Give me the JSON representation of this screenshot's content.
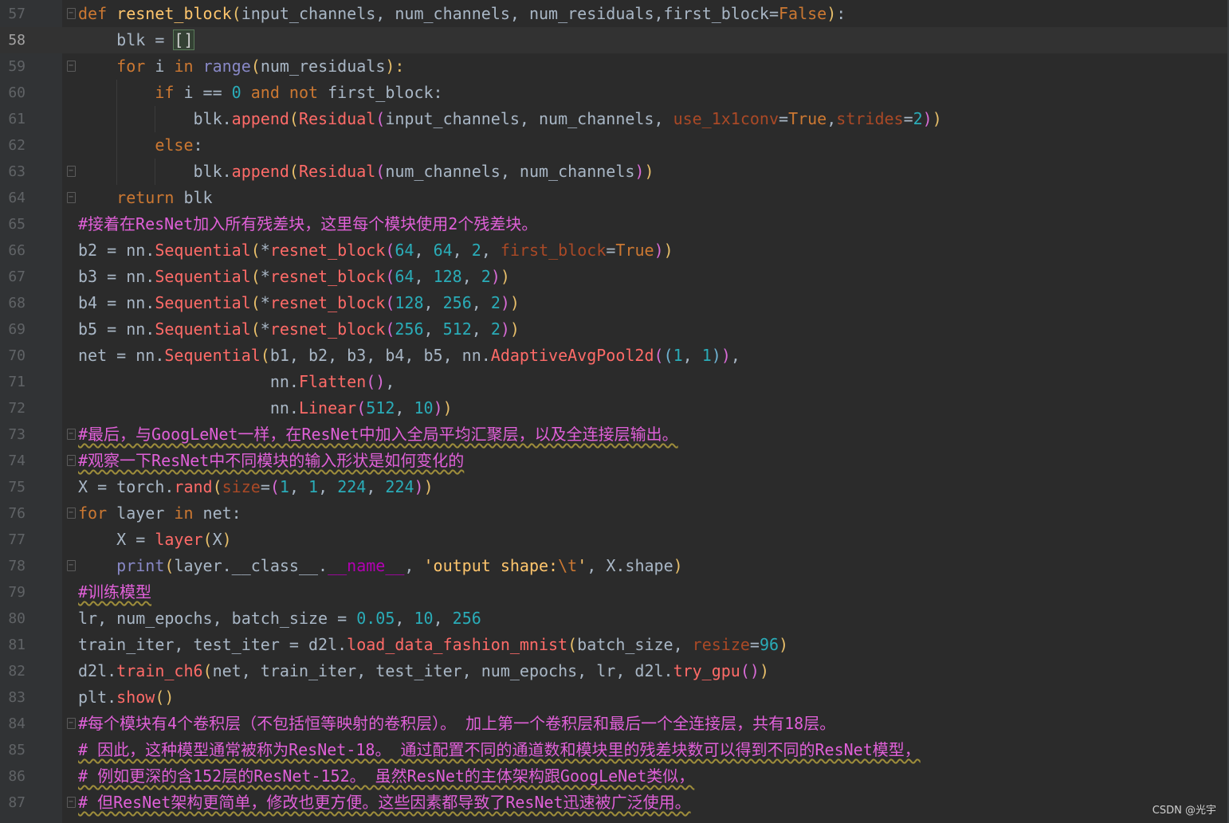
{
  "editor": {
    "lines": [
      {
        "n": "57",
        "fold": "open",
        "indent": 0,
        "current": false
      },
      {
        "n": "58",
        "fold": "",
        "indent": 1,
        "current": true
      },
      {
        "n": "59",
        "fold": "open",
        "indent": 1,
        "current": false
      },
      {
        "n": "60",
        "fold": "",
        "indent": 2,
        "current": false
      },
      {
        "n": "61",
        "fold": "",
        "indent": 3,
        "current": false
      },
      {
        "n": "62",
        "fold": "",
        "indent": 2,
        "current": false
      },
      {
        "n": "63",
        "fold": "close",
        "indent": 3,
        "current": false
      },
      {
        "n": "64",
        "fold": "close",
        "indent": 1,
        "current": false
      },
      {
        "n": "65",
        "fold": "",
        "indent": 0,
        "current": false
      },
      {
        "n": "66",
        "fold": "",
        "indent": 0,
        "current": false
      },
      {
        "n": "67",
        "fold": "",
        "indent": 0,
        "current": false
      },
      {
        "n": "68",
        "fold": "",
        "indent": 0,
        "current": false
      },
      {
        "n": "69",
        "fold": "",
        "indent": 0,
        "current": false
      },
      {
        "n": "70",
        "fold": "",
        "indent": 0,
        "current": false
      },
      {
        "n": "71",
        "fold": "",
        "indent": 0,
        "current": false
      },
      {
        "n": "72",
        "fold": "",
        "indent": 0,
        "current": false
      },
      {
        "n": "73",
        "fold": "open",
        "indent": 0,
        "current": false
      },
      {
        "n": "74",
        "fold": "close",
        "indent": 0,
        "current": false
      },
      {
        "n": "75",
        "fold": "",
        "indent": 0,
        "current": false
      },
      {
        "n": "76",
        "fold": "open",
        "indent": 0,
        "current": false
      },
      {
        "n": "77",
        "fold": "",
        "indent": 1,
        "current": false
      },
      {
        "n": "78",
        "fold": "close",
        "indent": 1,
        "current": false
      },
      {
        "n": "79",
        "fold": "",
        "indent": 0,
        "current": false
      },
      {
        "n": "80",
        "fold": "",
        "indent": 0,
        "current": false
      },
      {
        "n": "81",
        "fold": "",
        "indent": 0,
        "current": false
      },
      {
        "n": "82",
        "fold": "",
        "indent": 0,
        "current": false
      },
      {
        "n": "83",
        "fold": "",
        "indent": 0,
        "current": false
      },
      {
        "n": "84",
        "fold": "open",
        "indent": 0,
        "current": false
      },
      {
        "n": "85",
        "fold": "",
        "indent": 0,
        "current": false
      },
      {
        "n": "86",
        "fold": "",
        "indent": 0,
        "current": false
      },
      {
        "n": "87",
        "fold": "close",
        "indent": 0,
        "current": false
      }
    ],
    "code": [
      [
        [
          "kw",
          "def "
        ],
        [
          "fn",
          "resnet_block"
        ],
        [
          "br1",
          "("
        ],
        [
          "pn",
          "input_channels, num_channels, num_residuals,first_block="
        ],
        [
          "kw",
          "False"
        ],
        [
          "br1",
          ")"
        ],
        [
          "pn",
          ":"
        ]
      ],
      [
        [
          "pn",
          "    blk = "
        ],
        [
          "sel",
          "[]"
        ]
      ],
      [
        [
          "pn",
          "    "
        ],
        [
          "kw",
          "for "
        ],
        [
          "pn",
          "i "
        ],
        [
          "kw",
          "in "
        ],
        [
          "bi",
          "range"
        ],
        [
          "br1",
          "("
        ],
        [
          "pn",
          "num_residuals"
        ],
        [
          "br1",
          "):"
        ]
      ],
      [
        [
          "pn",
          "        "
        ],
        [
          "kw",
          "if "
        ],
        [
          "pn",
          "i == "
        ],
        [
          "num2",
          "0 "
        ],
        [
          "kw",
          "and not "
        ],
        [
          "pn",
          "first_block:"
        ]
      ],
      [
        [
          "pn",
          "            blk."
        ],
        [
          "call",
          "append"
        ],
        [
          "br1",
          "("
        ],
        [
          "call",
          "Residual"
        ],
        [
          "br2",
          "("
        ],
        [
          "pn",
          "input_channels, num_channels, "
        ],
        [
          "pa",
          "use_1x1conv"
        ],
        [
          "pn",
          "="
        ],
        [
          "kw",
          "True"
        ],
        [
          "pn",
          ","
        ],
        [
          "pa",
          "strides"
        ],
        [
          "pn",
          "="
        ],
        [
          "num2",
          "2"
        ],
        [
          "br2",
          ")"
        ],
        [
          "br1",
          ")"
        ]
      ],
      [
        [
          "pn",
          "        "
        ],
        [
          "kw",
          "else"
        ],
        [
          "pn",
          ":"
        ]
      ],
      [
        [
          "pn",
          "            blk."
        ],
        [
          "call",
          "append"
        ],
        [
          "br1",
          "("
        ],
        [
          "call",
          "Residual"
        ],
        [
          "br2",
          "("
        ],
        [
          "pn",
          "num_channels, num_channels"
        ],
        [
          "br2",
          ")"
        ],
        [
          "br1",
          ")"
        ]
      ],
      [
        [
          "pn",
          "    "
        ],
        [
          "kw",
          "return "
        ],
        [
          "pn",
          "blk"
        ]
      ],
      [
        [
          "cm",
          "#接着在ResNet加入所有残差块，这里每个模块使用2个残差块。"
        ]
      ],
      [
        [
          "pn",
          "b2 = nn."
        ],
        [
          "call",
          "Sequential"
        ],
        [
          "br1",
          "("
        ],
        [
          "pn",
          "*"
        ],
        [
          "call",
          "resnet_block"
        ],
        [
          "br2",
          "("
        ],
        [
          "num2",
          "64"
        ],
        [
          "pn",
          ", "
        ],
        [
          "num2",
          "64"
        ],
        [
          "pn",
          ", "
        ],
        [
          "num2",
          "2"
        ],
        [
          "pn",
          ", "
        ],
        [
          "pa",
          "first_block"
        ],
        [
          "pn",
          "="
        ],
        [
          "kw",
          "True"
        ],
        [
          "br2",
          ")"
        ],
        [
          "br1",
          ")"
        ]
      ],
      [
        [
          "pn",
          "b3 = nn."
        ],
        [
          "call",
          "Sequential"
        ],
        [
          "br1",
          "("
        ],
        [
          "pn",
          "*"
        ],
        [
          "call",
          "resnet_block"
        ],
        [
          "br2",
          "("
        ],
        [
          "num2",
          "64"
        ],
        [
          "pn",
          ", "
        ],
        [
          "num2",
          "128"
        ],
        [
          "pn",
          ", "
        ],
        [
          "num2",
          "2"
        ],
        [
          "br2",
          ")"
        ],
        [
          "br1",
          ")"
        ]
      ],
      [
        [
          "pn",
          "b4 = nn."
        ],
        [
          "call",
          "Sequential"
        ],
        [
          "br1",
          "("
        ],
        [
          "pn",
          "*"
        ],
        [
          "call",
          "resnet_block"
        ],
        [
          "br2",
          "("
        ],
        [
          "num2",
          "128"
        ],
        [
          "pn",
          ", "
        ],
        [
          "num2",
          "256"
        ],
        [
          "pn",
          ", "
        ],
        [
          "num2",
          "2"
        ],
        [
          "br2",
          ")"
        ],
        [
          "br1",
          ")"
        ]
      ],
      [
        [
          "pn",
          "b5 = nn."
        ],
        [
          "call",
          "Sequential"
        ],
        [
          "br1",
          "("
        ],
        [
          "pn",
          "*"
        ],
        [
          "call",
          "resnet_block"
        ],
        [
          "br2",
          "("
        ],
        [
          "num2",
          "256"
        ],
        [
          "pn",
          ", "
        ],
        [
          "num2",
          "512"
        ],
        [
          "pn",
          ", "
        ],
        [
          "num2",
          "2"
        ],
        [
          "br2",
          ")"
        ],
        [
          "br1",
          ")"
        ]
      ],
      [
        [
          "pn",
          "net = nn."
        ],
        [
          "call",
          "Sequential"
        ],
        [
          "br1",
          "("
        ],
        [
          "pn",
          "b1, b2, b3, b4, b5, nn."
        ],
        [
          "call",
          "AdaptiveAvgPool2d"
        ],
        [
          "br2",
          "("
        ],
        [
          "br3",
          "("
        ],
        [
          "num2",
          "1"
        ],
        [
          "pn",
          ", "
        ],
        [
          "num2",
          "1"
        ],
        [
          "br3",
          ")"
        ],
        [
          "br2",
          ")"
        ],
        [
          "pn",
          ","
        ]
      ],
      [
        [
          "pn",
          "                    nn."
        ],
        [
          "call",
          "Flatten"
        ],
        [
          "br2",
          "()"
        ],
        [
          "pn",
          ","
        ]
      ],
      [
        [
          "pn",
          "                    nn."
        ],
        [
          "call",
          "Linear"
        ],
        [
          "br2",
          "("
        ],
        [
          "num2",
          "512"
        ],
        [
          "pn",
          ", "
        ],
        [
          "num2",
          "10"
        ],
        [
          "br2",
          ")"
        ],
        [
          "br1",
          ")"
        ]
      ],
      [
        [
          "cm",
          "#最后，与GoogLeNet一样，在ResNet中加入全局平均汇聚层，以及全连接层输出。"
        ]
      ],
      [
        [
          "cm",
          "#观察一下ResNet中不同模块的输入形状是如何变化的"
        ]
      ],
      [
        [
          "pn",
          "X = torch."
        ],
        [
          "call",
          "rand"
        ],
        [
          "br1",
          "("
        ],
        [
          "pa",
          "size"
        ],
        [
          "pn",
          "="
        ],
        [
          "br2",
          "("
        ],
        [
          "num2",
          "1"
        ],
        [
          "pn",
          ", "
        ],
        [
          "num2",
          "1"
        ],
        [
          "pn",
          ", "
        ],
        [
          "num2",
          "224"
        ],
        [
          "pn",
          ", "
        ],
        [
          "num2",
          "224"
        ],
        [
          "br2",
          ")"
        ],
        [
          "br1",
          ")"
        ]
      ],
      [
        [
          "kw",
          "for "
        ],
        [
          "pn",
          "layer "
        ],
        [
          "kw",
          "in "
        ],
        [
          "pn",
          "net:"
        ]
      ],
      [
        [
          "pn",
          "    X = "
        ],
        [
          "call",
          "layer"
        ],
        [
          "br1",
          "("
        ],
        [
          "pn",
          "X"
        ],
        [
          "br1",
          ")"
        ]
      ],
      [
        [
          "pn",
          "    "
        ],
        [
          "bi",
          "print"
        ],
        [
          "br1",
          "("
        ],
        [
          "pn",
          "layer.__class__."
        ],
        [
          "magic",
          "__name__"
        ],
        [
          "pn",
          ", "
        ],
        [
          "fn",
          "'output shape:"
        ],
        [
          "esc",
          "\\t"
        ],
        [
          "fn",
          "'"
        ],
        [
          "pn",
          ", X.shape"
        ],
        [
          "br1",
          ")"
        ]
      ],
      [
        [
          "cm",
          "#训练模型"
        ]
      ],
      [
        [
          "pn",
          "lr, num_epochs, batch_size = "
        ],
        [
          "num2",
          "0.05"
        ],
        [
          "pn",
          ", "
        ],
        [
          "num2",
          "10"
        ],
        [
          "pn",
          ", "
        ],
        [
          "num2",
          "256"
        ]
      ],
      [
        [
          "pn",
          "train_iter, test_iter = d2l."
        ],
        [
          "call",
          "load_data_fashion_mnist"
        ],
        [
          "br1",
          "("
        ],
        [
          "pn",
          "batch_size, "
        ],
        [
          "pa",
          "resize"
        ],
        [
          "pn",
          "="
        ],
        [
          "num2",
          "96"
        ],
        [
          "br1",
          ")"
        ]
      ],
      [
        [
          "pn",
          "d2l."
        ],
        [
          "call",
          "train_ch6"
        ],
        [
          "br1",
          "("
        ],
        [
          "pn",
          "net, train_iter, test_iter, num_epochs, lr, d2l."
        ],
        [
          "call",
          "try_gpu"
        ],
        [
          "br2",
          "()"
        ],
        [
          "br1",
          ")"
        ]
      ],
      [
        [
          "pn",
          "plt."
        ],
        [
          "call",
          "show"
        ],
        [
          "br1",
          "()"
        ]
      ],
      [
        [
          "cm",
          "#每个模块有4个卷积层（不包括恒等映射的卷积层）。 加上第一个卷积层和最后一个全连接层，共有18层。"
        ]
      ],
      [
        [
          "cm",
          "# 因此，这种模型通常被称为ResNet-18。 通过配置不同的通道数和模块里的残差块数可以得到不同的ResNet模型，"
        ]
      ],
      [
        [
          "cm",
          "# 例如更深的含152层的ResNet-152。 虽然ResNet的主体架构跟GoogLeNet类似，"
        ]
      ],
      [
        [
          "cm",
          "# 但ResNet架构更简单，修改也更方便。这些因素都导致了ResNet迅速被广泛使用。"
        ]
      ]
    ]
  },
  "watermark": "CSDN @光宇"
}
